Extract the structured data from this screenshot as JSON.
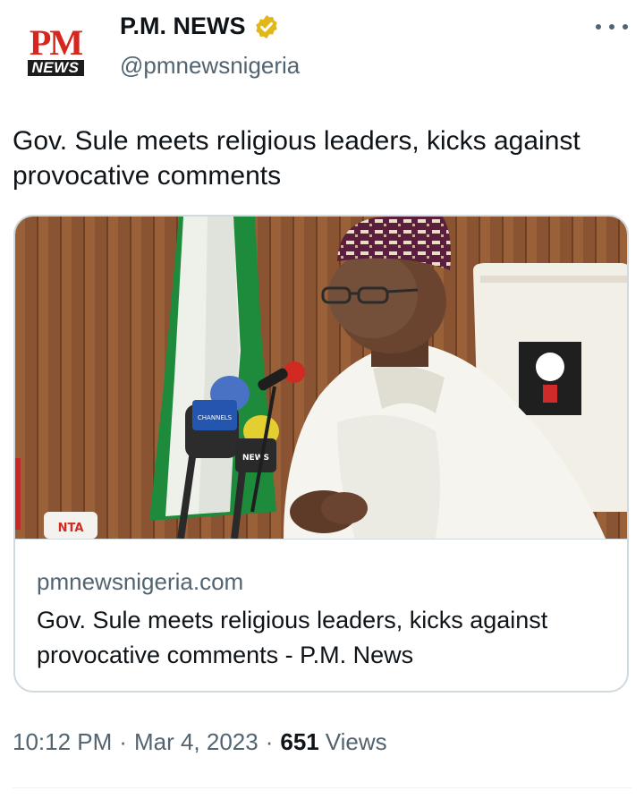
{
  "account": {
    "display_name": "P.M. NEWS",
    "handle": "@pmnewsnigeria",
    "logo_top": "PM",
    "logo_bottom": "NEWS",
    "verified_badge_color": "#e2b719"
  },
  "tweet": {
    "text": "Gov. Sule meets religious leaders, kicks against provocative comments"
  },
  "link_card": {
    "domain": "pmnewsnigeria.com",
    "title": "Gov. Sule meets religious leaders, kicks against provocative comments - P.M. News",
    "image_mic_labels": [
      "CHANNELS",
      "NEWS",
      "NTA"
    ]
  },
  "meta": {
    "time": "10:12 PM",
    "separator": "·",
    "date": "Mar 4, 2023",
    "views_count": "651",
    "views_label": "Views"
  },
  "icons": {
    "more": "more-horizontal-icon",
    "verified": "verified-badge-icon"
  },
  "colors": {
    "text_primary": "#0f1419",
    "text_secondary": "#536471",
    "border": "#cfd9de",
    "brand_red": "#d7261e"
  }
}
